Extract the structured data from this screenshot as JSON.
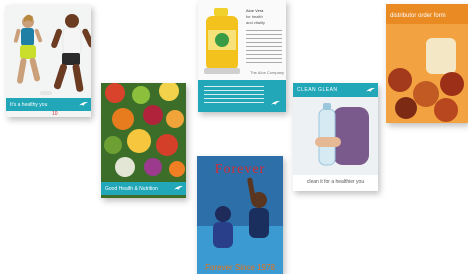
{
  "brochures": [
    {
      "id": "fitness",
      "title": "It's a healthy you",
      "page_marker": "10"
    },
    {
      "id": "fruit",
      "title": "Good Health & Nutrition"
    },
    {
      "id": "aloe",
      "body_lines": [
        "Aloe Vera",
        "for health",
        "and vitality"
      ],
      "footer": "The Aloe Company"
    },
    {
      "id": "travel",
      "title": "Forever",
      "footer": "Forever Since 1978"
    },
    {
      "id": "water",
      "brand": "CLEAN GLEAN",
      "caption": "clean it for a healthier you"
    },
    {
      "id": "distributor",
      "title": "distributor order form"
    }
  ],
  "colors": {
    "teal": "#22a7b8",
    "orange": "#e8731a",
    "red": "#d22b32"
  }
}
